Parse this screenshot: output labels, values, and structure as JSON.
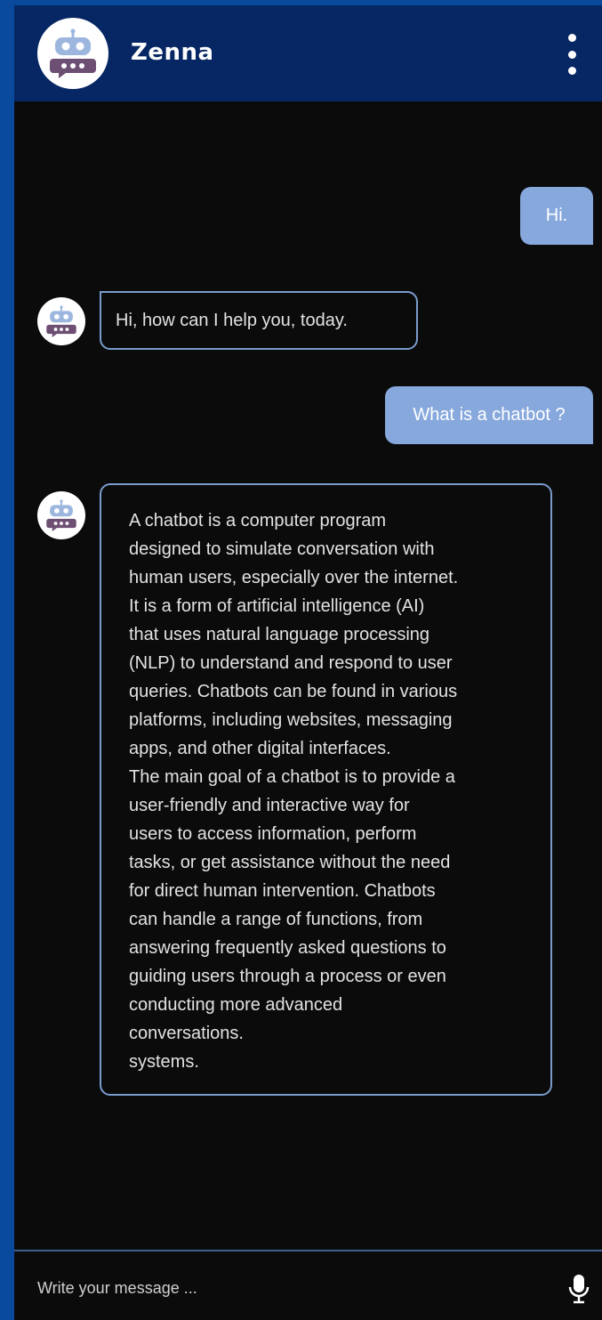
{
  "header": {
    "title": "Zenna",
    "avatar_icon": "robot-chat-icon",
    "menu_icon": "kebab-menu-icon"
  },
  "messages": [
    {
      "sender": "user",
      "text": "Hi."
    },
    {
      "sender": "bot",
      "text": "Hi, how can I help you, today."
    },
    {
      "sender": "user",
      "text": "What is a chatbot ?"
    },
    {
      "sender": "bot",
      "text": "A chatbot is a computer program\ndesigned to simulate conversation with\nhuman users, especially over the internet.\nIt is a form of artificial intelligence (AI)\nthat uses natural language processing\n(NLP) to understand and respond to user\nqueries. Chatbots can be found in various\nplatforms, including websites, messaging\napps, and other digital interfaces.\nThe main goal of a chatbot is to provide a\nuser-friendly and interactive way for\nusers to access information, perform\ntasks, or get assistance without the need\nfor direct human intervention. Chatbots\ncan handle a range of functions, from\nanswering frequently asked questions to\nguiding users through a process or even\nconducting more advanced\nconversations.\nsystems."
    }
  ],
  "composer": {
    "placeholder": "Write your message ...",
    "value": "",
    "mic_icon": "microphone-icon"
  },
  "colors": {
    "header_bg": "#062763",
    "chat_bg": "#0b0b0c",
    "user_bubble": "#86a8dc",
    "bot_border": "#7a9ccc",
    "frame": "#0a4a9c"
  }
}
